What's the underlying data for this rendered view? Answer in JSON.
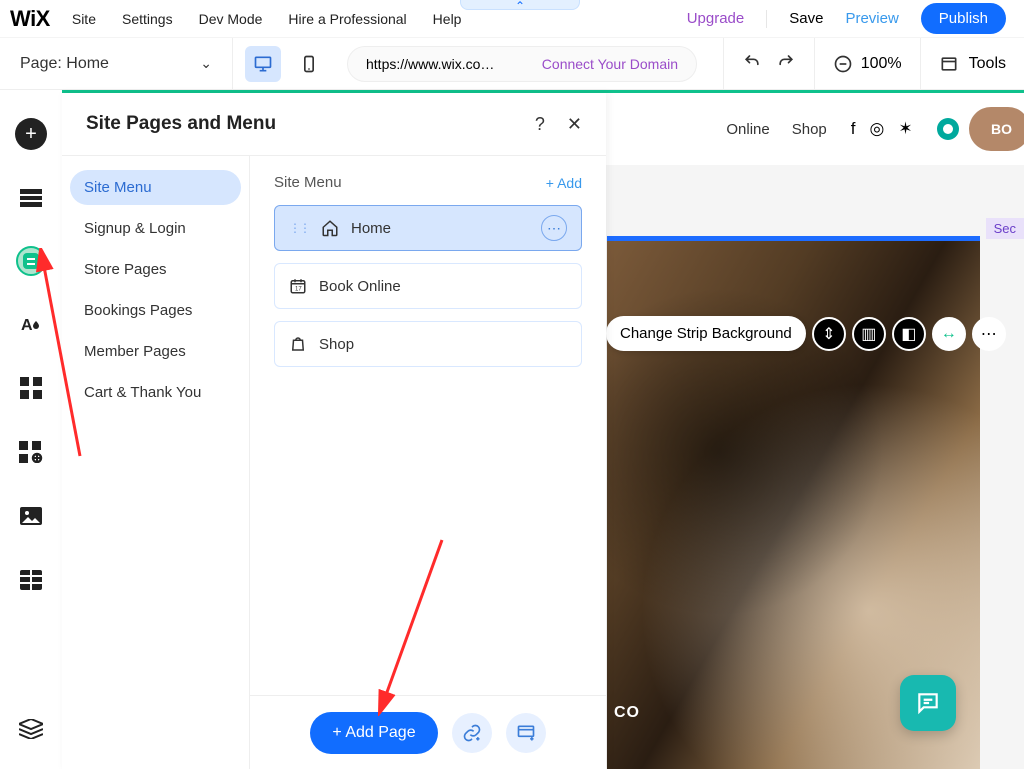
{
  "menubar": {
    "logo": "WiX",
    "items": [
      "Site",
      "Settings",
      "Dev Mode",
      "Hire a Professional",
      "Help"
    ],
    "upgrade": "Upgrade",
    "save": "Save",
    "preview": "Preview",
    "publish": "Publish"
  },
  "toolbar": {
    "page_label": "Page:",
    "page_name": "Home",
    "url": "https://www.wix.co…",
    "connect_domain": "Connect Your Domain",
    "zoom": "100%",
    "tools": "Tools"
  },
  "panel": {
    "title": "Site Pages and Menu",
    "sidebar": {
      "items": [
        "Site Menu",
        "Signup & Login",
        "Store Pages",
        "Bookings Pages",
        "Member Pages",
        "Cart & Thank You"
      ],
      "active_index": 0
    },
    "main": {
      "header": "Site Menu",
      "add": "+ Add",
      "pages": [
        {
          "label": "Home",
          "icon": "home",
          "active": true
        },
        {
          "label": "Book Online",
          "icon": "calendar",
          "active": false
        },
        {
          "label": "Shop",
          "icon": "bag",
          "active": false
        }
      ]
    },
    "footer": {
      "add_page": "+ Add Page"
    }
  },
  "canvas": {
    "nav": [
      "Online",
      "Shop"
    ],
    "book_btn": "BO",
    "section_tag": "Sec",
    "strip_label": "Change Strip Background",
    "trim_text": "CO"
  }
}
